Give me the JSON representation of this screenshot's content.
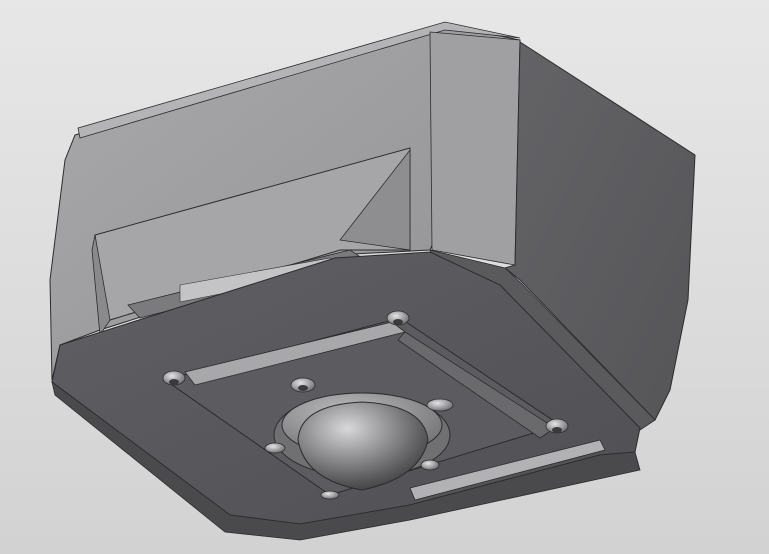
{
  "viewport": {
    "background_color": "#dedede"
  },
  "model": {
    "description_hidden": "",
    "colors": {
      "top_light": "#a3a3a5",
      "top_face": "#9a9a9c",
      "right_face": "#5d5d60",
      "front_face": "#6c6c6f",
      "recess_dark": "#4e4e51",
      "underside": "#595a5d",
      "dome_highlight": "#d4d4d6",
      "dome_shadow": "#3a3a3d",
      "edge_line": "#2c2c2e"
    },
    "features": {
      "screw_count": 4,
      "dome_bolt_count": 4
    }
  }
}
